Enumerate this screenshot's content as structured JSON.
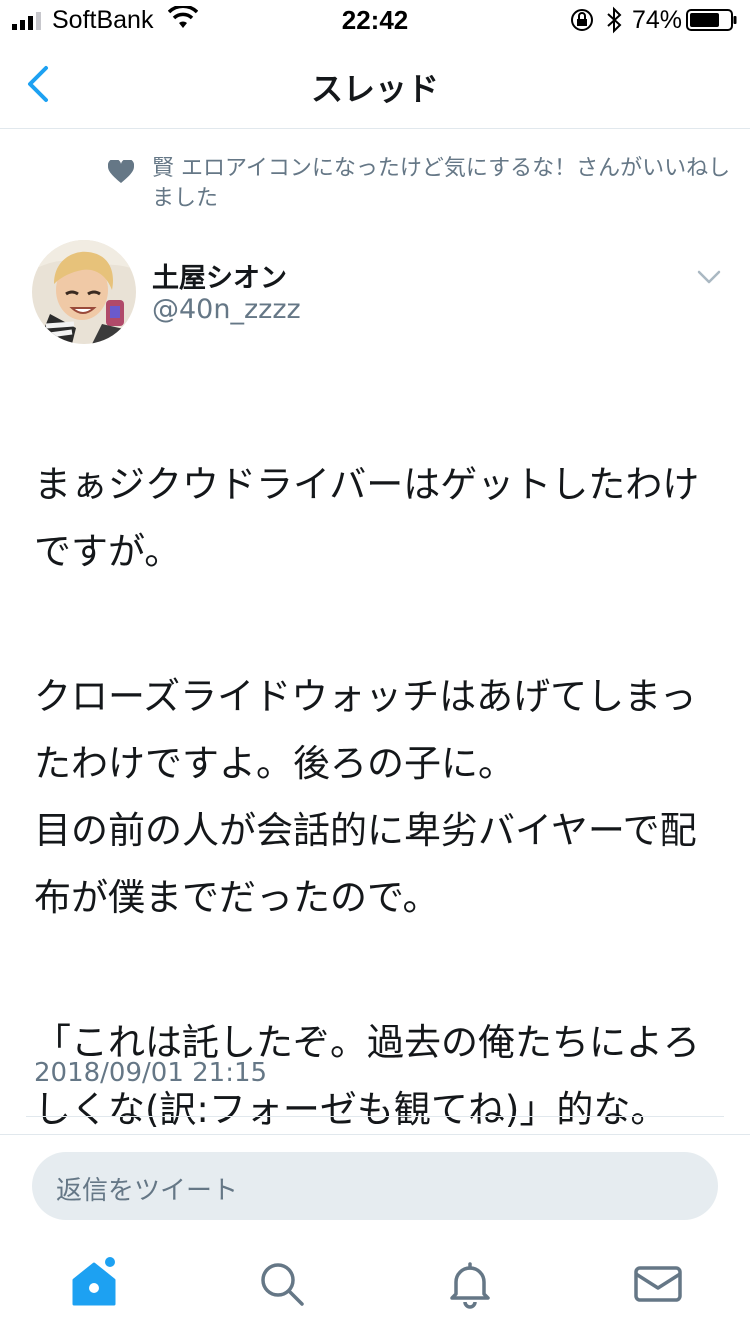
{
  "status_bar": {
    "carrier": "SoftBank",
    "time": "22:42",
    "battery_percent": "74%",
    "battery_level": 0.74
  },
  "nav": {
    "title": "スレッド"
  },
  "like_context": {
    "text": "賢 エロアイコンになったけど気にするな！さんがいいねしました"
  },
  "tweet": {
    "author_name": "土屋シオン",
    "author_handle": "@40n_zzzz",
    "paragraphs": [
      "まぁジクウドライバーはゲットしたわけですが。",
      "クローズライドウォッチはあげてしまったわけですよ。後ろの子に。\n目の前の人が会話的に卑劣バイヤーで配布が僕までだったので。",
      "「これは託したぞ。過去の俺たちによろしくな(訳:フォーゼも観てね)」的な。"
    ],
    "timestamp": "2018/09/01 21:15"
  },
  "reply": {
    "placeholder": "返信をツイート"
  },
  "colors": {
    "accent": "#1da1f2",
    "secondary_text": "#657786",
    "divider": "#e1e8ed",
    "reply_bg": "#e6ecf0"
  },
  "icons": {
    "back": "chevron-left-icon",
    "heart": "heart-icon",
    "caret": "chevron-down-icon",
    "home": "home-icon",
    "search": "search-icon",
    "notifications": "bell-icon",
    "messages": "envelope-icon"
  }
}
